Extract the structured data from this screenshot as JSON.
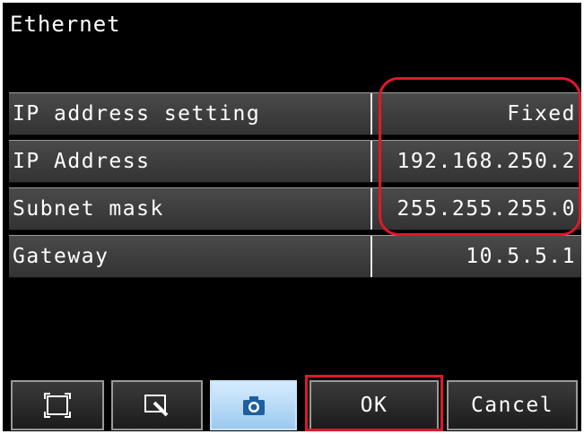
{
  "title": "Ethernet",
  "rows": [
    {
      "label": "IP address setting",
      "value": "Fixed"
    },
    {
      "label": "IP Address",
      "value": "192.168.250.2"
    },
    {
      "label": "Subnet mask",
      "value": "255.255.255.0"
    },
    {
      "label": "Gateway",
      "value": "10.5.5.1"
    }
  ],
  "toolbar": {
    "icons": [
      "frame-icon",
      "zoom-icon",
      "camera-icon"
    ],
    "ok_label": "OK",
    "cancel_label": "Cancel"
  },
  "colors": {
    "highlight": "#e0182a",
    "active_button": "#9cc9ee",
    "background": "#000000"
  }
}
